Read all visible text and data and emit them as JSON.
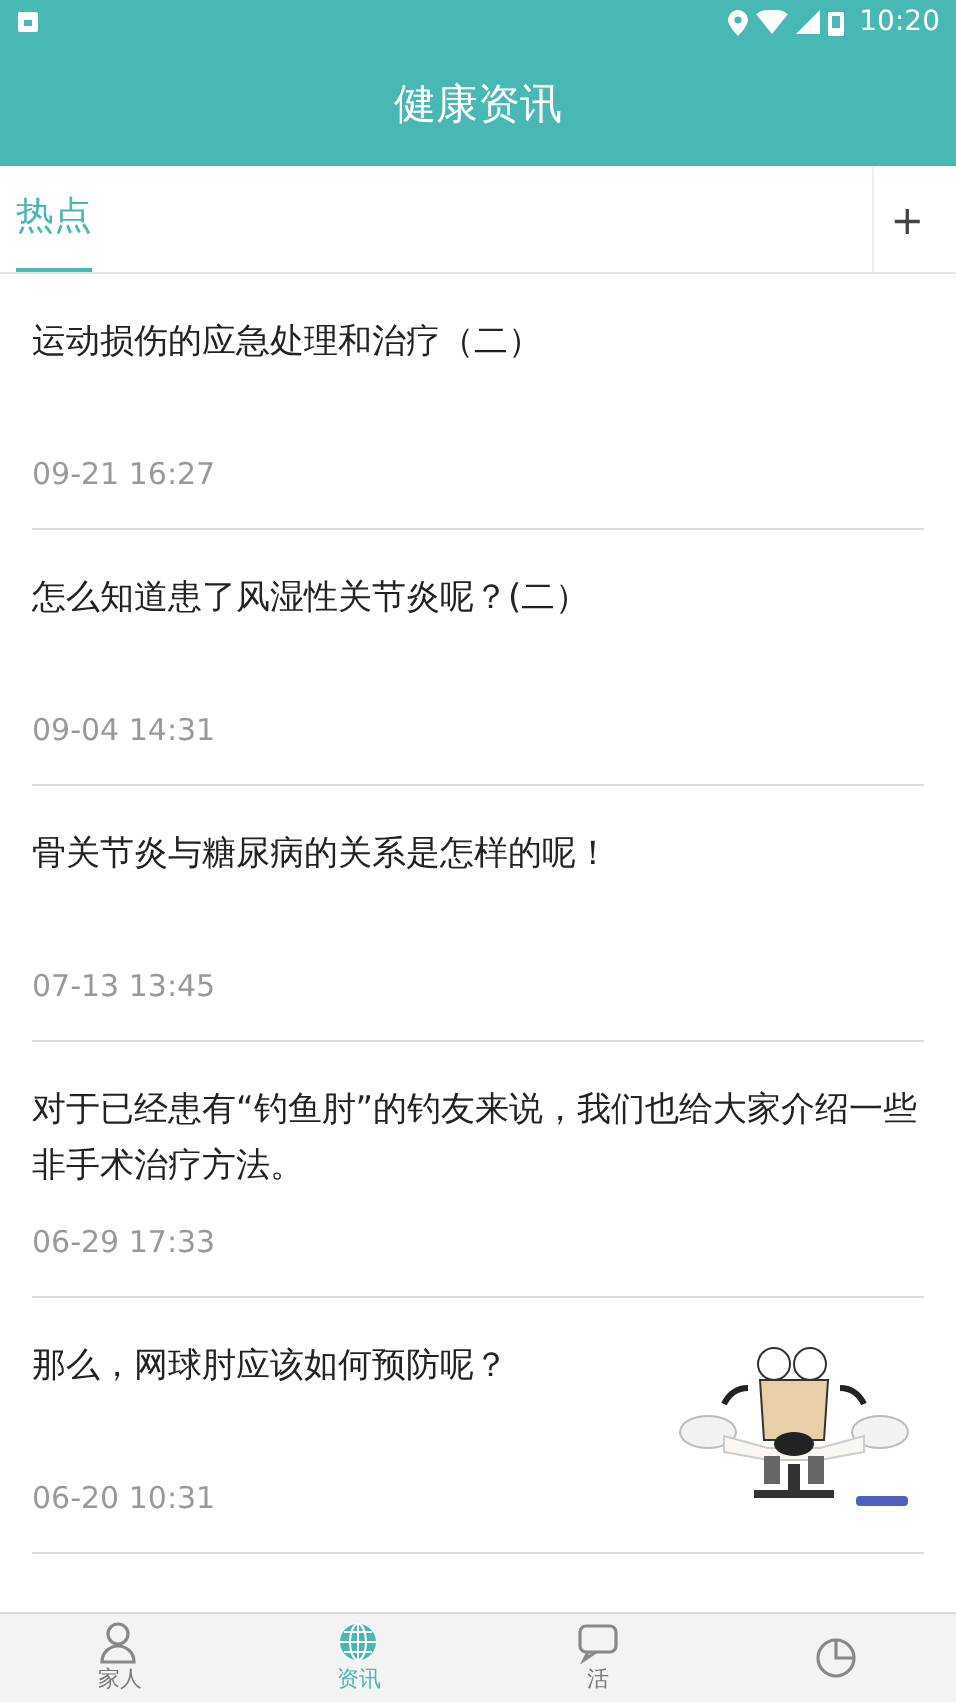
{
  "status_bar": {
    "time": "10:20"
  },
  "header": {
    "title": "健康资讯"
  },
  "tabs": [
    {
      "label": "热点",
      "selected": true
    }
  ],
  "add_tab": {
    "label": "+"
  },
  "articles": [
    {
      "title": "运动损伤的应急处理和治疗（二）",
      "time": "09-21 16:27"
    },
    {
      "title": "怎么知道患了风湿性关节炎呢？(二）",
      "time": "09-04 14:31"
    },
    {
      "title": "骨关节炎与糖尿病的关系是怎样的呢！",
      "time": "07-13 13:45"
    },
    {
      "title": "对于已经患有“钓鱼肘”的钓友来说，我们也给大家介绍一些非手术治疗方法。",
      "time": "06-29 17:33"
    },
    {
      "title": "那么，网球肘应该如何预防呢？",
      "time": "06-20 10:31",
      "kind": "picture"
    }
  ],
  "nav": [
    {
      "label": "家人",
      "selected": false,
      "kind": "person"
    },
    {
      "label": "资讯",
      "selected": true,
      "kind": "globe"
    },
    {
      "label": "活",
      "selected": false,
      "kind": "chat"
    },
    {
      "selected": false,
      "kind": "data"
    }
  ]
}
